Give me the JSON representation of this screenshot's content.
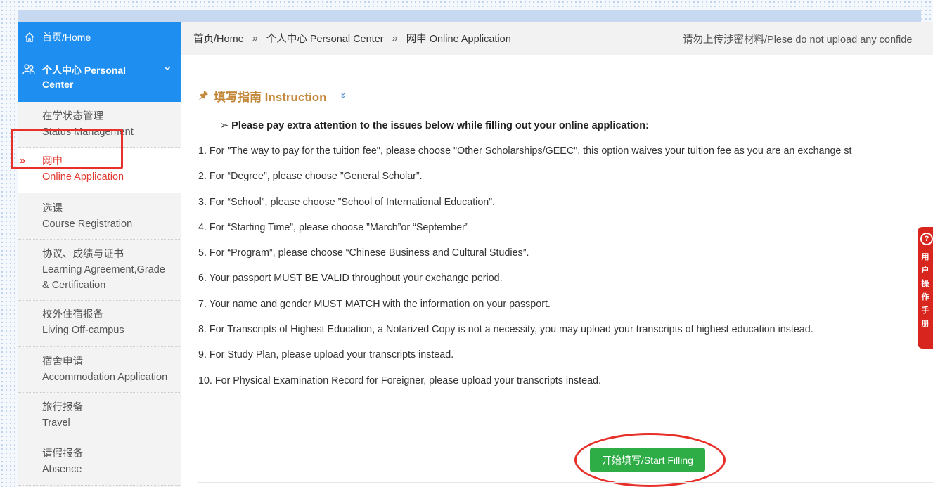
{
  "sidebar": {
    "home": "首页/Home",
    "personal_center": "个人中心 Personal Center",
    "items": [
      {
        "zh": "在学状态管理",
        "en": "Status Management"
      },
      {
        "zh": "网申",
        "en": "Online Application",
        "active": true
      },
      {
        "zh": "选课",
        "en": "Course Registration"
      },
      {
        "zh": "协议、成绩与证书",
        "en": "Learning Agreement,Grade",
        "en2": "& Certification"
      },
      {
        "zh": "校外住宿报备",
        "en": "Living Off-campus"
      },
      {
        "zh": "宿舍申请",
        "en": "Accommodation Application"
      },
      {
        "zh": "旅行报备",
        "en": "Travel"
      },
      {
        "zh": "请假报备",
        "en": "Absence"
      }
    ]
  },
  "breadcrumb": {
    "items": [
      "首页/Home",
      "个人中心 Personal Center",
      "网申 Online Application"
    ],
    "separator": "»",
    "warning": "请勿上传涉密材料/Plese do not upload any confide"
  },
  "instruction": {
    "title": "填写指南 Instruction",
    "attention": "➢  Please pay extra attention to the issues below while filling out your online application:",
    "items": [
      "1. For \"The way to pay for the tuition fee\", please choose \"Other Scholarships/GEEC\", this option waives your tuition fee as you are an exchange st",
      "2. For “Degree”, please choose ”General Scholar”.",
      "3. For “School”, please choose ”School of International Education”.",
      "4. For “Starting Time”, please choose ”March”or “September”",
      "5. For “Program”, please choose “Chinese Business and Cultural Studies”.",
      "6. Your passport MUST BE VALID throughout your exchange period.",
      "7. Your name and gender MUST MATCH with the information on your passport.",
      "8. For Transcripts of Highest Education, a Notarized Copy is not a necessity, you may upload your transcripts of highest education instead.",
      "9. For Study Plan, please upload your transcripts instead.",
      "10. For Physical Examination Record for Foreigner, please upload your transcripts instead."
    ]
  },
  "start_button": "开始填写/Start Filling",
  "help_tab": {
    "chars": [
      "用",
      "户",
      "操",
      "作",
      "手",
      "册"
    ]
  },
  "colors": {
    "sidebar_blue": "#1e8ef0",
    "active_red": "#e23b32",
    "button_green": "#2eac46",
    "instruction_orange": "#c3883a"
  },
  "icons": {
    "home": "home-icon",
    "personal": "users-icon",
    "expand": "chevron-down-icon",
    "active_marker": "double-chevron-right-icon",
    "instruction": "pin-icon",
    "collapse": "double-chevron-down-icon",
    "help": "question-circle-icon"
  }
}
